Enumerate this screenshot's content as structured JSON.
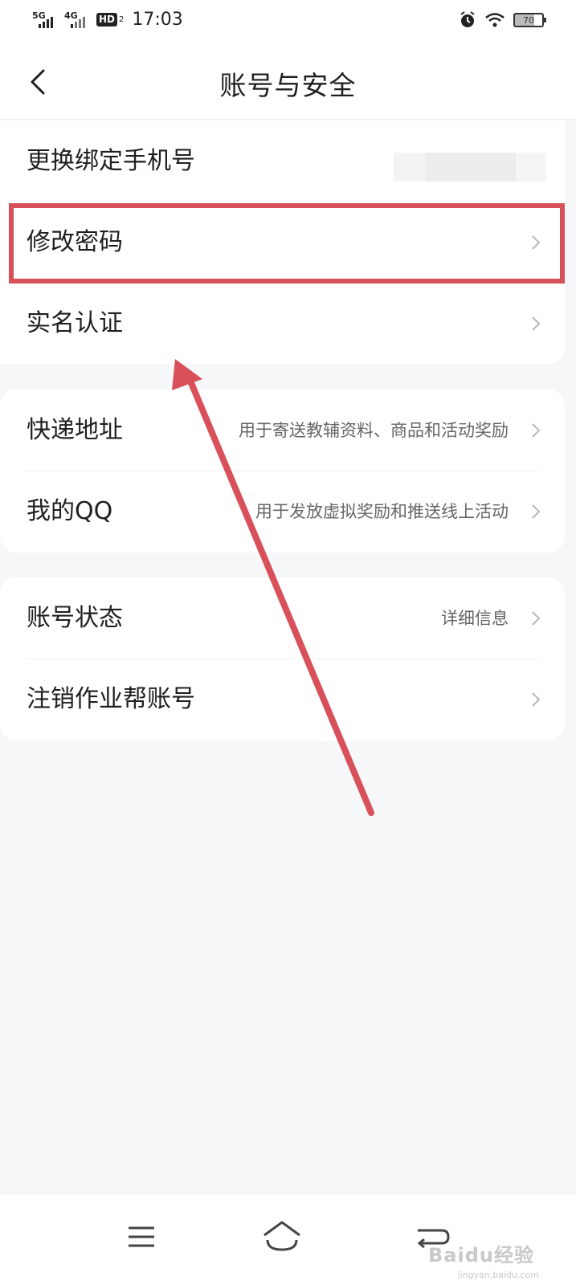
{
  "status_bar": {
    "network_1": "5G",
    "network_2": "4G",
    "hd": "HD",
    "hd_sub": "2",
    "time": "17:03",
    "battery": "70",
    "icons": [
      "alarm-icon",
      "wifi-icon",
      "battery-icon"
    ]
  },
  "header": {
    "title": "账号与安全",
    "back_icon": "chevron-left-icon"
  },
  "groups": [
    {
      "items": [
        {
          "label": "更换绑定手机号",
          "detail": ""
        },
        {
          "label": "修改密码",
          "detail": ""
        },
        {
          "label": "实名认证",
          "detail": ""
        }
      ]
    },
    {
      "items": [
        {
          "label": "快递地址",
          "detail": "用于寄送教辅资料、商品和活动奖励"
        },
        {
          "label": "我的QQ",
          "detail": "用于发放虚拟奖励和推送线上活动"
        }
      ]
    },
    {
      "items": [
        {
          "label": "账号状态",
          "detail": "详细信息"
        },
        {
          "label": "注销作业帮账号",
          "detail": ""
        }
      ]
    }
  ],
  "annotation": {
    "highlight_color": "#d8505a",
    "highlighted_item": "修改密码"
  },
  "bottom_nav": {
    "icons": [
      "menu-icon",
      "home-icon",
      "back-icon"
    ]
  },
  "watermark": {
    "text": "Baidu经验",
    "sub": "jingyan.baidu.com"
  },
  "colors": {
    "background": "#f6f7f9",
    "card": "#ffffff",
    "text": "#1f1f1f",
    "secondary_text": "#666666"
  }
}
